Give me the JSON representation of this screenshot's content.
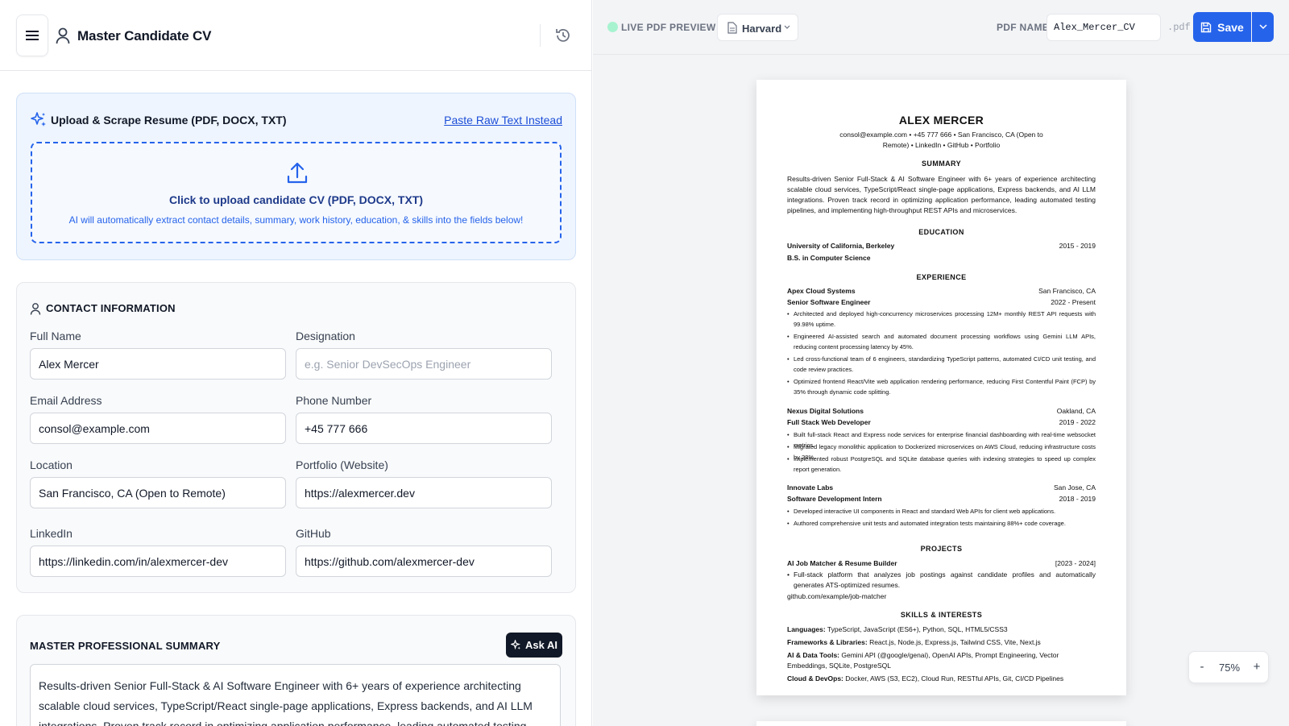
{
  "header": {
    "title": "Master Candidate CV"
  },
  "upload": {
    "title": "Upload & Scrape Resume (PDF, DOCX, TXT)",
    "paste_link": "Paste Raw Text Instead",
    "drop_title": "Click to upload candidate CV (PDF, DOCX, TXT)",
    "drop_sub": "AI will automatically extract contact details, summary, work history, education, & skills into the fields below!"
  },
  "contact": {
    "title": "CONTACT INFORMATION",
    "full_name": {
      "label": "Full Name",
      "value": "Alex Mercer"
    },
    "designation": {
      "label": "Designation",
      "placeholder": "e.g. Senior DevSecOps Engineer"
    },
    "email": {
      "label": "Email Address",
      "value": "consol@example.com"
    },
    "phone": {
      "label": "Phone Number",
      "value": "+45 777 666"
    },
    "location": {
      "label": "Location",
      "value": "San Francisco, CA (Open to Remote)"
    },
    "portfolio": {
      "label": "Portfolio (Website)",
      "value": "https://alexmercer.dev"
    },
    "linkedin": {
      "label": "LinkedIn",
      "value": "https://linkedin.com/in/alexmercer-dev"
    },
    "github": {
      "label": "GitHub",
      "value": "https://github.com/alexmercer-dev"
    }
  },
  "summary": {
    "title": "MASTER PROFESSIONAL SUMMARY",
    "ask_ai": "Ask AI",
    "text": "Results-driven Senior Full-Stack & AI Software Engineer with 6+ years of experience architecting scalable cloud services, TypeScript/React single-page applications, Express backends, and AI LLM integrations. Proven track record in optimizing application performance, leading automated testing pipelines, and implementing high-throughput REST APIs and microservices."
  },
  "preview": {
    "live_label": "LIVE PDF PREVIEW",
    "template": "Harvard",
    "pdf_name_label": "PDF NAME",
    "pdf_name": "Alex_Mercer_CV",
    "pdf_ext": ".pdf",
    "save": "Save",
    "zoom": "75%",
    "zoom_minus": "-",
    "zoom_plus": "+"
  },
  "cv": {
    "name": "ALEX MERCER",
    "contact_line1": "consol@example.com • +45 777 666 • San Francisco, CA (Open to",
    "contact_line2": "Remote) • LinkedIn • GitHub • Portfolio",
    "summary_h": "SUMMARY",
    "summary": "Results-driven Senior Full-Stack & AI Software Engineer with 6+ years of experience architecting scalable cloud services, TypeScript/React single-page applications, Express backends, and AI LLM integrations. Proven track record in optimizing application performance, leading automated testing pipelines, and implementing high-throughput REST APIs and microservices.",
    "education_h": "EDUCATION",
    "edu_school": "University of California, Berkeley",
    "edu_years": "2015 - 2019",
    "edu_degree": "B.S. in Computer Science",
    "experience_h": "EXPERIENCE",
    "jobs": [
      {
        "company": "Apex Cloud Systems",
        "location": "San Francisco, CA",
        "role": "Senior Software Engineer",
        "dates": "2022 - Present",
        "bullets": [
          "Architected and deployed high-concurrency microservices processing 12M+ monthly REST API requests with 99.98% uptime.",
          "Engineered AI-assisted search and automated document processing workflows using Gemini LLM APIs, reducing content processing latency by 45%.",
          "Led cross-functional team of 6 engineers, standardizing TypeScript patterns, automated CI/CD unit testing, and code review practices.",
          "Optimized frontend React/Vite web application rendering performance, reducing First Contentful Paint (FCP) by 35% through dynamic code splitting."
        ]
      },
      {
        "company": "Nexus Digital Solutions",
        "location": "Oakland, CA",
        "role": "Full Stack Web Developer",
        "dates": "2019 - 2022",
        "bullets": [
          "Built full-stack React and Express node services for enterprise financial dashboarding with real-time websocket metrics.",
          "Migrated legacy monolithic application to Dockerized microservices on AWS Cloud, reducing infrastructure costs by 28%.",
          "Implemented robust PostgreSQL and SQLite database queries with indexing strategies to speed up complex report generation."
        ]
      },
      {
        "company": "Innovate Labs",
        "location": "San Jose, CA",
        "role": "Software Development Intern",
        "dates": "2018 - 2019",
        "bullets": [
          "Developed interactive UI components in React and standard Web APIs for client web applications.",
          "Authored comprehensive unit tests and automated integration tests maintaining 88%+ code coverage."
        ]
      }
    ],
    "projects_h": "PROJECTS",
    "project_name": "AI Job Matcher & Resume Builder",
    "project_dates": "[2023 - 2024]",
    "project_desc": "Full-stack platform that analyzes job postings against candidate profiles and automatically generates ATS-optimized resumes.",
    "project_link": "github.com/example/job-matcher",
    "skills_h": "SKILLS & INTERESTS",
    "skills": [
      {
        "label": "Languages:",
        "value": "TypeScript, JavaScript (ES6+), Python, SQL, HTML5/CSS3"
      },
      {
        "label": "Frameworks & Libraries:",
        "value": "React.js, Node.js, Express.js, Tailwind CSS, Vite, Next.js"
      },
      {
        "label": "AI & Data Tools:",
        "value": "Gemini API (@google/genai), OpenAI APIs, Prompt Engineering, Vector Embeddings, SQLite, PostgreSQL"
      },
      {
        "label": "Cloud & DevOps:",
        "value": "Docker, AWS (S3, EC2), Cloud Run, RESTful APIs, Git, CI/CD Pipelines"
      }
    ]
  }
}
